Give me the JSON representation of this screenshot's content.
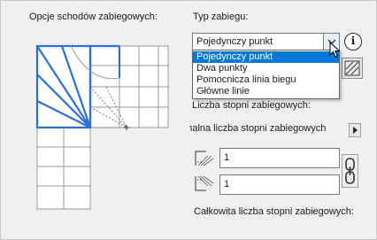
{
  "panel": {
    "left_title": "Opcje schodów zabiegowych:",
    "right_title": "Typ zabiegu:"
  },
  "winder_type": {
    "selected": "Pojedynczy punkt",
    "options": [
      "Pojedynczy punkt",
      "Dwa punkty",
      "Pomocnicza linia biegu",
      "Główne linie"
    ],
    "highlighted_index": 0
  },
  "info_button": {
    "label": "i"
  },
  "winder_count": {
    "label": "Liczba stopni zabiegowych:",
    "mode_text": "Minimalna liczba stopni zabiegowych",
    "start_value": "1",
    "end_value": "1",
    "total_label": "Całkowita liczba stopni zabiegowych:"
  },
  "colors": {
    "accent": "#0078d7",
    "stair_outline": "#2f6fd6",
    "panel_bg": "#f0f0f0"
  },
  "icons": {
    "dropdown_arrow": "chevron-down-icon",
    "info": "info-icon",
    "tool": "winder-tool-icon",
    "popup": "triangle-right-icon",
    "start_step": "winder-start-icon",
    "end_step": "winder-end-icon",
    "link": "chain-link-icon",
    "cursor": "mouse-pointer-icon"
  }
}
